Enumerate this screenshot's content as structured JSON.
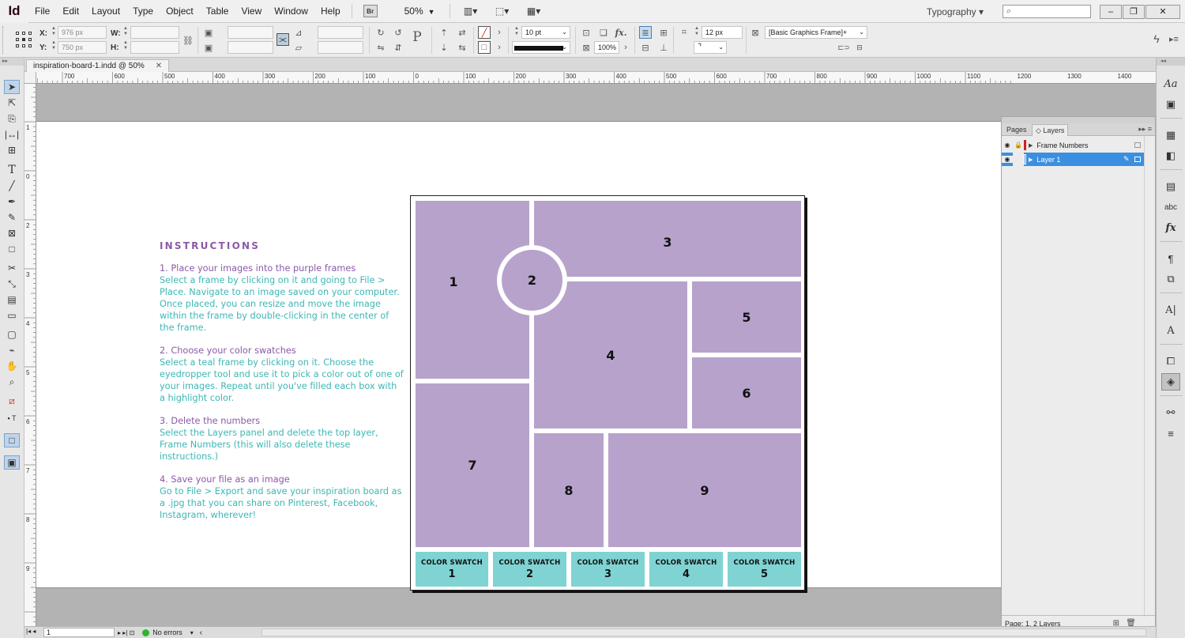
{
  "menubar": {
    "app_logo": "Id",
    "items": [
      "File",
      "Edit",
      "Layout",
      "Type",
      "Object",
      "Table",
      "View",
      "Window",
      "Help"
    ],
    "bridge_label": "Br",
    "zoom": "50%",
    "workspace": "Typography",
    "search_placeholder": ""
  },
  "control": {
    "x_label": "X:",
    "y_label": "Y:",
    "w_label": "W:",
    "h_label": "H:",
    "x_value": "976 px",
    "y_value": "750 px",
    "font_size": "10 pt",
    "scale": "100%",
    "spacing": "12 px",
    "object_style": "[Basic Graphics Frame]+"
  },
  "document": {
    "tab_title": "inspiration-board-1.indd @ 50%"
  },
  "ruler": {
    "h_ticks": [
      "700",
      "600",
      "500",
      "400",
      "300",
      "200",
      "100",
      "0",
      "100",
      "200",
      "300",
      "400",
      "500",
      "600",
      "700",
      "800",
      "900",
      "1000",
      "1100",
      "1200",
      "1300",
      "1400"
    ],
    "v_ticks": [
      "1",
      "0",
      "2",
      "3",
      "4",
      "5",
      "6",
      "7",
      "8",
      "9"
    ]
  },
  "instructions": {
    "title": "INSTRUCTIONS",
    "steps": [
      {
        "heading": "1. Place your images into the purple frames",
        "body": "Select a frame by clicking on it and going to File > Place. Navigate to an image saved on your computer. Once placed, you can resize and move the image within the frame by double-clicking in the center of the frame."
      },
      {
        "heading": "2. Choose your color swatches",
        "body": "Select a teal frame by clicking on it. Choose the eyedropper tool and use it to pick a color out of one of your images. Repeat until you've filled each box with a highlight color."
      },
      {
        "heading": "3. Delete the numbers",
        "body": "Select the Layers panel and delete the top layer, Frame Numbers (this will also delete these instructions.)"
      },
      {
        "heading": "4. Save your file as an image",
        "body": "Go to File > Export and save your inspiration board as a .jpg that you can share on Pinterest, Facebook, Instagram, wherever!"
      }
    ]
  },
  "board": {
    "frame_color": "#b7a2cc",
    "swatch_color": "#7fd3d3",
    "frames": [
      "1",
      "2",
      "3",
      "4",
      "5",
      "6",
      "7",
      "8",
      "9"
    ],
    "swatch_label": "COLOR SWATCH",
    "swatches": [
      "1",
      "2",
      "3",
      "4",
      "5"
    ]
  },
  "layers_panel": {
    "tabs": [
      "Pages",
      "Layers"
    ],
    "active_tab": "Layers",
    "layers": [
      {
        "name": "Frame Numbers",
        "color": "#d32020",
        "selected": false
      },
      {
        "name": "Layer 1",
        "color": "#3b8fe0",
        "selected": true
      }
    ],
    "status": "Page: 1, 2 Layers"
  },
  "statusbar": {
    "page": "1",
    "preflight": "No errors"
  }
}
